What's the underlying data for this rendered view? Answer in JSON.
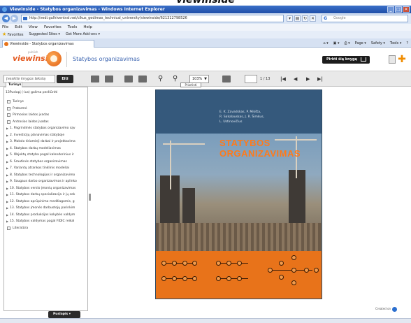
{
  "header_caption": "viewinside",
  "window": {
    "title": "Viewinside - Statybos organizavimas - Windows Internet Explorer",
    "controls": [
      "_",
      "□",
      "✕"
    ]
  },
  "browser": {
    "address": "http://vedi.gulhiventral.net/clkus_gedimas_technical_university/viewinside/621312798526",
    "search_placeholder": "Google",
    "menu": [
      "File",
      "Edit",
      "View",
      "Favorites",
      "Tools",
      "Help"
    ],
    "favorites_label": "Favorites",
    "favorite_links": [
      "Suggested Sites ▾",
      "Get More Add-ons ▾"
    ],
    "tab_title": "Viewinside - Statybos organizavimas",
    "commands": [
      "Page ▾",
      "Safety ▾",
      "Tools ▾"
    ]
  },
  "viewer": {
    "logo_text": "viewinside",
    "logo_sup": "publish",
    "doc_title": "Statybos organizavimas",
    "buy_label": "Pirkti šią knygą",
    "search_placeholder": "Įveskite knygos tekstą",
    "go_label": "Eiti",
    "zoom_value": "103%",
    "zoom_tooltip": "Priartinti",
    "page_total": "1 / 13",
    "created_on": "Created on"
  },
  "sidebar": {
    "tab_label": "Turinys",
    "heading": "13Puslapį (-ius) galima peržiūrėti",
    "footer_button": "Puslapis ▾",
    "items": [
      {
        "label": "Turinys",
        "kind": "page"
      },
      {
        "label": "Pratarmė",
        "kind": "page"
      },
      {
        "label": "Pirmosios laidos įvadas",
        "kind": "page"
      },
      {
        "label": "Antrosios laidos įvadas",
        "kind": "page"
      },
      {
        "label": "1. Pagrindinės statybos organizavimo sąv",
        "kind": "chapter"
      },
      {
        "label": "2. Investicijų planavimas statyboje",
        "kind": "chapter"
      },
      {
        "label": "3. Mokslo tiriamieji darbai ir projektavima",
        "kind": "chapter"
      },
      {
        "label": "4. Statybos darbų modeliavimas",
        "kind": "chapter"
      },
      {
        "label": "5. Objektų statyba pagal kalendorinius ir",
        "kind": "chapter"
      },
      {
        "label": "6. Srautinės statybos organizavimas",
        "kind": "chapter"
      },
      {
        "label": "7. Variantų atrankos tinklinis modeliai",
        "kind": "chapter"
      },
      {
        "label": "8. Statybos technologijos ir organizavimo",
        "kind": "chapter"
      },
      {
        "label": "9. Saugaus darbo organizavimas ir aplinko",
        "kind": "chapter"
      },
      {
        "label": "10. Statybos verslo įmonių organizavimas",
        "kind": "chapter"
      },
      {
        "label": "11. Statybos darbų specializacija ir jų sek",
        "kind": "chapter"
      },
      {
        "label": "12. Statybos aprūpinimo medžiagomis, g",
        "kind": "chapter"
      },
      {
        "label": "13. Statybos įmonės darbuotojų parinkim",
        "kind": "chapter"
      },
      {
        "label": "14. Statybos produkcijos kokybės valdym",
        "kind": "chapter"
      },
      {
        "label": "15. Statybos valdymas pagal FIDIC reikal",
        "kind": "chapter"
      },
      {
        "label": "Literatūra",
        "kind": "page"
      }
    ]
  },
  "book": {
    "authors": [
      "E. K. Zavadskas, P. Mikšta,",
      "R. Sakalauskas, J. R. Šimkus,",
      "L. Ustinovičius"
    ],
    "title_lines": [
      "STATYBOS",
      "ORGANIZAVIMAS"
    ]
  },
  "colors": {
    "accent": "#e3581e",
    "book_orange": "#e8731a",
    "book_blue": "#35597c",
    "title_orange": "#ff7a1a"
  }
}
